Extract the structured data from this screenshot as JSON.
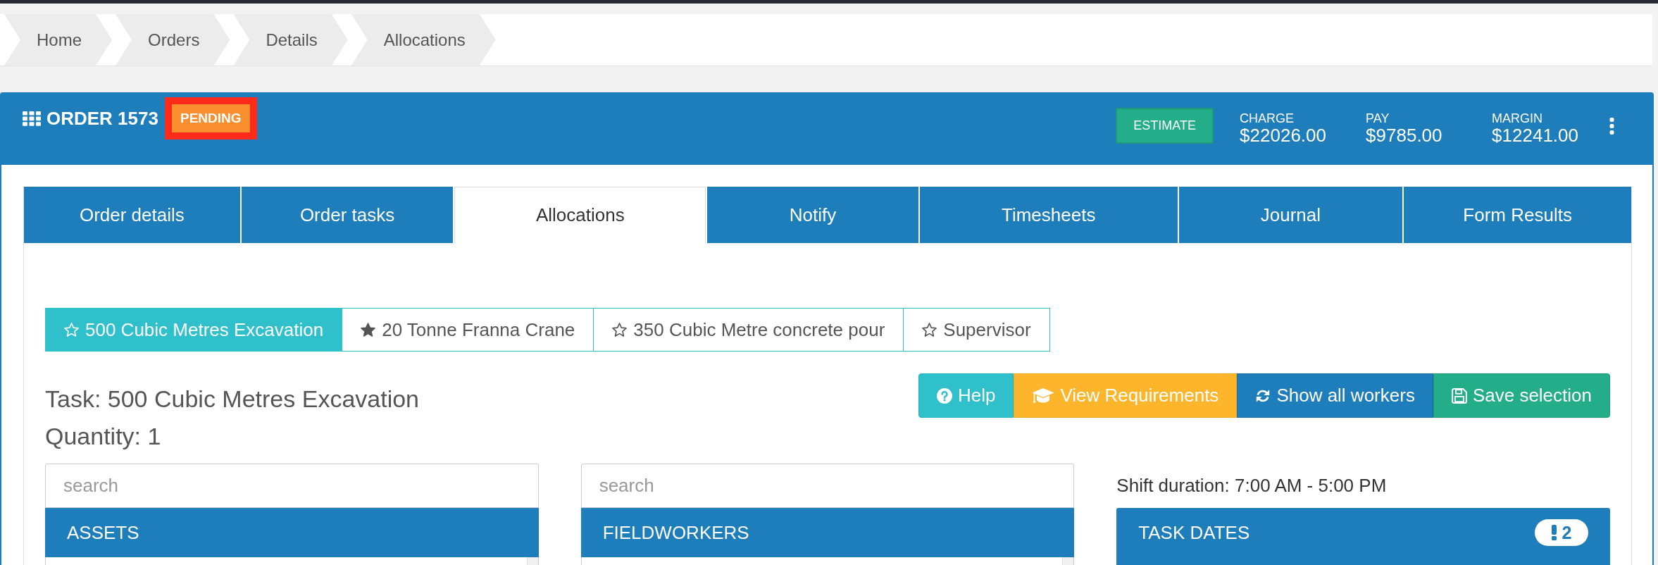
{
  "breadcrumbs": [
    "Home",
    "Orders",
    "Details",
    "Allocations"
  ],
  "order": {
    "title": "ORDER 1573",
    "status": {
      "label": "PENDING",
      "highlighted": true
    },
    "estimate_button": "ESTIMATE",
    "totals": [
      {
        "label": "CHARGE",
        "value": "$22026.00"
      },
      {
        "label": "PAY",
        "value": "$9785.00"
      },
      {
        "label": "MARGIN",
        "value": "$12241.00"
      }
    ]
  },
  "tabs": [
    {
      "label": "Order details",
      "selected": false
    },
    {
      "label": "Order tasks",
      "selected": false
    },
    {
      "label": "Allocations",
      "selected": true
    },
    {
      "label": "Notify",
      "selected": false
    },
    {
      "label": "Timesheets",
      "selected": false
    },
    {
      "label": "Journal",
      "selected": false
    },
    {
      "label": "Form Results",
      "selected": false
    }
  ],
  "task_chips": [
    {
      "label": "500 Cubic Metres Excavation",
      "selected": true,
      "starred": false
    },
    {
      "label": "20 Tonne Franna Crane",
      "selected": false,
      "starred": true
    },
    {
      "label": "350 Cubic Metre concrete pour",
      "selected": false,
      "starred": false
    },
    {
      "label": "Supervisor",
      "selected": false,
      "starred": false
    }
  ],
  "task": {
    "title": "Task: 500 Cubic Metres Excavation",
    "quantity": "Quantity: 1"
  },
  "actions": [
    {
      "label": "Help",
      "kind": "help"
    },
    {
      "label": "View Requirements",
      "kind": "requirements"
    },
    {
      "label": "Show all workers",
      "kind": "refresh"
    },
    {
      "label": "Save selection",
      "kind": "save"
    }
  ],
  "assets": {
    "search": {
      "placeholder": "search"
    },
    "title": "ASSETS"
  },
  "fieldworkers": {
    "search": {
      "placeholder": "search"
    },
    "title": "FIELDWORKERS"
  },
  "task_dates": {
    "shift_duration": "Shift duration: 7:00 AM - 5:00 PM",
    "title": "TASK DATES",
    "alert_count": "2"
  }
}
